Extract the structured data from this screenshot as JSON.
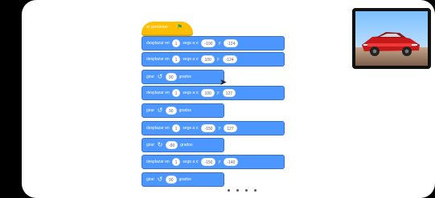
{
  "scratch": {
    "hat_label": "al presionar",
    "flag_icon": "green-flag-icon",
    "video_preview": {
      "subject": "red-car"
    },
    "blocks": [
      {
        "kind": "glide",
        "label_start": "desplazar en",
        "value_1": "1",
        "label_middle": "segs a x:",
        "x_value": "-100",
        "label_y": "y:",
        "y_value": "-124"
      },
      {
        "kind": "glide",
        "label_start": "desplazar en",
        "value_1": "1",
        "label_middle": "segs a x:",
        "x_value": "100",
        "label_y": "y:",
        "y_value": "-124"
      },
      {
        "kind": "turn",
        "label_start": "girar",
        "direction_icon": "counterclockwise-icon",
        "degrees": "90",
        "label_end": "grados"
      },
      {
        "kind": "glide",
        "label_start": "desplazar en",
        "value_1": "1",
        "label_middle": "segs a x:",
        "x_value": "100",
        "label_y": "y:",
        "y_value": "127"
      },
      {
        "kind": "turn",
        "label_start": "girar",
        "direction_icon": "counterclockwise-icon",
        "degrees": "90",
        "label_end": "grados"
      },
      {
        "kind": "glide",
        "label_start": "desplazar en",
        "value_1": "1",
        "label_middle": "segs a x:",
        "x_value": "-150",
        "label_y": "y:",
        "y_value": "127"
      },
      {
        "kind": "turn",
        "label_start": "girar",
        "direction_icon": "clockwise-icon",
        "degrees": "-90",
        "label_end": "grados"
      },
      {
        "kind": "glide",
        "label_start": "desplazar en",
        "value_1": "1",
        "label_middle": "segs a x:",
        "x_value": "-150",
        "label_y": "y:",
        "y_value": "-140"
      },
      {
        "kind": "turn",
        "label_start": "girar",
        "direction_icon": "counterclockwise-icon",
        "degrees": "90",
        "label_end": "grados"
      }
    ],
    "pager": {
      "count": 4
    },
    "colors": {
      "hat": "#ffbf00",
      "motion": "#4c97ff",
      "motion_border": "#3373cc",
      "stage_background": "#ffffff"
    }
  }
}
